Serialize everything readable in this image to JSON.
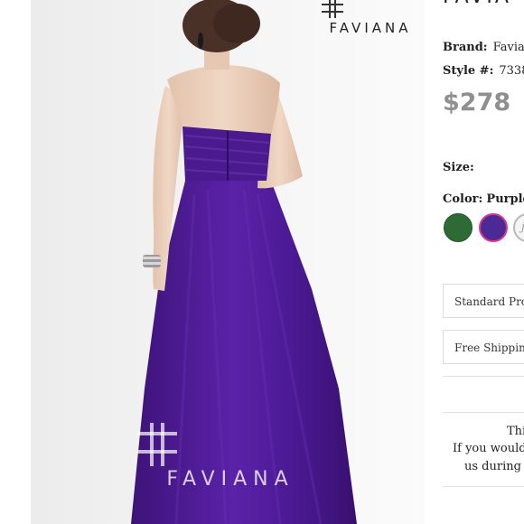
{
  "brand_logo": {
    "text": "FAVIANA",
    "icon": "faviana-monogram-icon"
  },
  "watermark": {
    "text": "FAVIANA",
    "icon": "faviana-monogram-icon"
  },
  "product": {
    "title_fragment": "FAVIA",
    "brand_label": "Brand:",
    "brand_value": "Favia",
    "style_label": "Style #:",
    "style_value": "7338",
    "price": "$278",
    "size_label": "Size:",
    "color_label": "Color:",
    "color_value": "Purple",
    "swatches": [
      {
        "name": "green",
        "color": "#2e6a35"
      },
      {
        "name": "purple",
        "color": "#4b2a96",
        "selected": true
      },
      {
        "name": "ivory",
        "color": "#f5f5f5"
      }
    ]
  },
  "shipping": {
    "standard_label": "Standard Proc",
    "free_label": "Free Shipping"
  },
  "notice": {
    "line1": "Thi",
    "line2": "If you would",
    "line3": "us during"
  },
  "colors": {
    "dress": "#4d1a94",
    "price_gray": "#8f8f8f",
    "selected_ring": "#d93c8d"
  }
}
